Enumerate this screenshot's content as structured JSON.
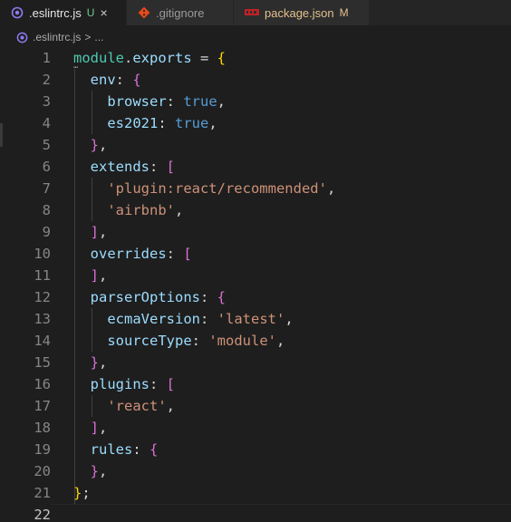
{
  "tabs": [
    {
      "name": ".eslintrc.js",
      "status": "U",
      "close": "×",
      "icon": "eslint-icon",
      "status_color": "#73c991"
    },
    {
      "name": ".gitignore",
      "icon": "git-icon"
    },
    {
      "name": "package.json",
      "status": "M",
      "icon": "npm-icon",
      "name_color": "#e2c08d",
      "status_color": "#e2c08d"
    }
  ],
  "breadcrumb": {
    "file": ".eslintrc.js",
    "separator": ">",
    "symbol": "..."
  },
  "editor": {
    "current_line": 22,
    "lines": [
      {
        "n": "1",
        "tokens": [
          [
            "k",
            "module"
          ],
          [
            "o",
            "."
          ],
          [
            "p",
            "exports"
          ],
          [
            "o",
            " = "
          ],
          [
            "b1",
            "{"
          ]
        ]
      },
      {
        "n": "2",
        "tokens": [
          [
            "o",
            "  "
          ],
          [
            "p",
            "env"
          ],
          [
            "o",
            ": "
          ],
          [
            "b2",
            "{"
          ]
        ]
      },
      {
        "n": "3",
        "tokens": [
          [
            "o",
            "    "
          ],
          [
            "p",
            "browser"
          ],
          [
            "o",
            ": "
          ],
          [
            "v",
            "true"
          ],
          [
            "o",
            ","
          ]
        ]
      },
      {
        "n": "4",
        "tokens": [
          [
            "o",
            "    "
          ],
          [
            "p",
            "es2021"
          ],
          [
            "o",
            ": "
          ],
          [
            "v",
            "true"
          ],
          [
            "o",
            ","
          ]
        ]
      },
      {
        "n": "5",
        "tokens": [
          [
            "o",
            "  "
          ],
          [
            "b2",
            "}"
          ],
          [
            "o",
            ","
          ]
        ]
      },
      {
        "n": "6",
        "tokens": [
          [
            "o",
            "  "
          ],
          [
            "p",
            "extends"
          ],
          [
            "o",
            ": "
          ],
          [
            "b2",
            "["
          ]
        ]
      },
      {
        "n": "7",
        "tokens": [
          [
            "o",
            "    "
          ],
          [
            "s",
            "'plugin:react/recommended'"
          ],
          [
            "o",
            ","
          ]
        ]
      },
      {
        "n": "8",
        "tokens": [
          [
            "o",
            "    "
          ],
          [
            "s",
            "'airbnb'"
          ],
          [
            "o",
            ","
          ]
        ]
      },
      {
        "n": "9",
        "tokens": [
          [
            "o",
            "  "
          ],
          [
            "b2",
            "]"
          ],
          [
            "o",
            ","
          ]
        ]
      },
      {
        "n": "10",
        "tokens": [
          [
            "o",
            "  "
          ],
          [
            "p",
            "overrides"
          ],
          [
            "o",
            ": "
          ],
          [
            "b2",
            "["
          ]
        ]
      },
      {
        "n": "11",
        "tokens": [
          [
            "o",
            "  "
          ],
          [
            "b2",
            "]"
          ],
          [
            "o",
            ","
          ]
        ]
      },
      {
        "n": "12",
        "tokens": [
          [
            "o",
            "  "
          ],
          [
            "p",
            "parserOptions"
          ],
          [
            "o",
            ": "
          ],
          [
            "b2",
            "{"
          ]
        ]
      },
      {
        "n": "13",
        "tokens": [
          [
            "o",
            "    "
          ],
          [
            "p",
            "ecmaVersion"
          ],
          [
            "o",
            ": "
          ],
          [
            "s",
            "'latest'"
          ],
          [
            "o",
            ","
          ]
        ]
      },
      {
        "n": "14",
        "tokens": [
          [
            "o",
            "    "
          ],
          [
            "p",
            "sourceType"
          ],
          [
            "o",
            ": "
          ],
          [
            "s",
            "'module'"
          ],
          [
            "o",
            ","
          ]
        ]
      },
      {
        "n": "15",
        "tokens": [
          [
            "o",
            "  "
          ],
          [
            "b2",
            "}"
          ],
          [
            "o",
            ","
          ]
        ]
      },
      {
        "n": "16",
        "tokens": [
          [
            "o",
            "  "
          ],
          [
            "p",
            "plugins"
          ],
          [
            "o",
            ": "
          ],
          [
            "b2",
            "["
          ]
        ]
      },
      {
        "n": "17",
        "tokens": [
          [
            "o",
            "    "
          ],
          [
            "s",
            "'react'"
          ],
          [
            "o",
            ","
          ]
        ]
      },
      {
        "n": "18",
        "tokens": [
          [
            "o",
            "  "
          ],
          [
            "b2",
            "]"
          ],
          [
            "o",
            ","
          ]
        ]
      },
      {
        "n": "19",
        "tokens": [
          [
            "o",
            "  "
          ],
          [
            "p",
            "rules"
          ],
          [
            "o",
            ": "
          ],
          [
            "b2",
            "{"
          ]
        ]
      },
      {
        "n": "20",
        "tokens": [
          [
            "o",
            "  "
          ],
          [
            "b2",
            "}"
          ],
          [
            "o",
            ","
          ]
        ]
      },
      {
        "n": "21",
        "tokens": [
          [
            "b1",
            "}"
          ],
          [
            "o",
            ";"
          ]
        ]
      },
      {
        "n": "22",
        "tokens": []
      }
    ]
  },
  "colors": {
    "keyword_teal": "#4ec9b0",
    "property": "#9cdcfe",
    "boolean": "#569cd6",
    "string": "#ce9178",
    "bracket_outer": "#ffd700",
    "bracket_inner": "#da70d6"
  }
}
